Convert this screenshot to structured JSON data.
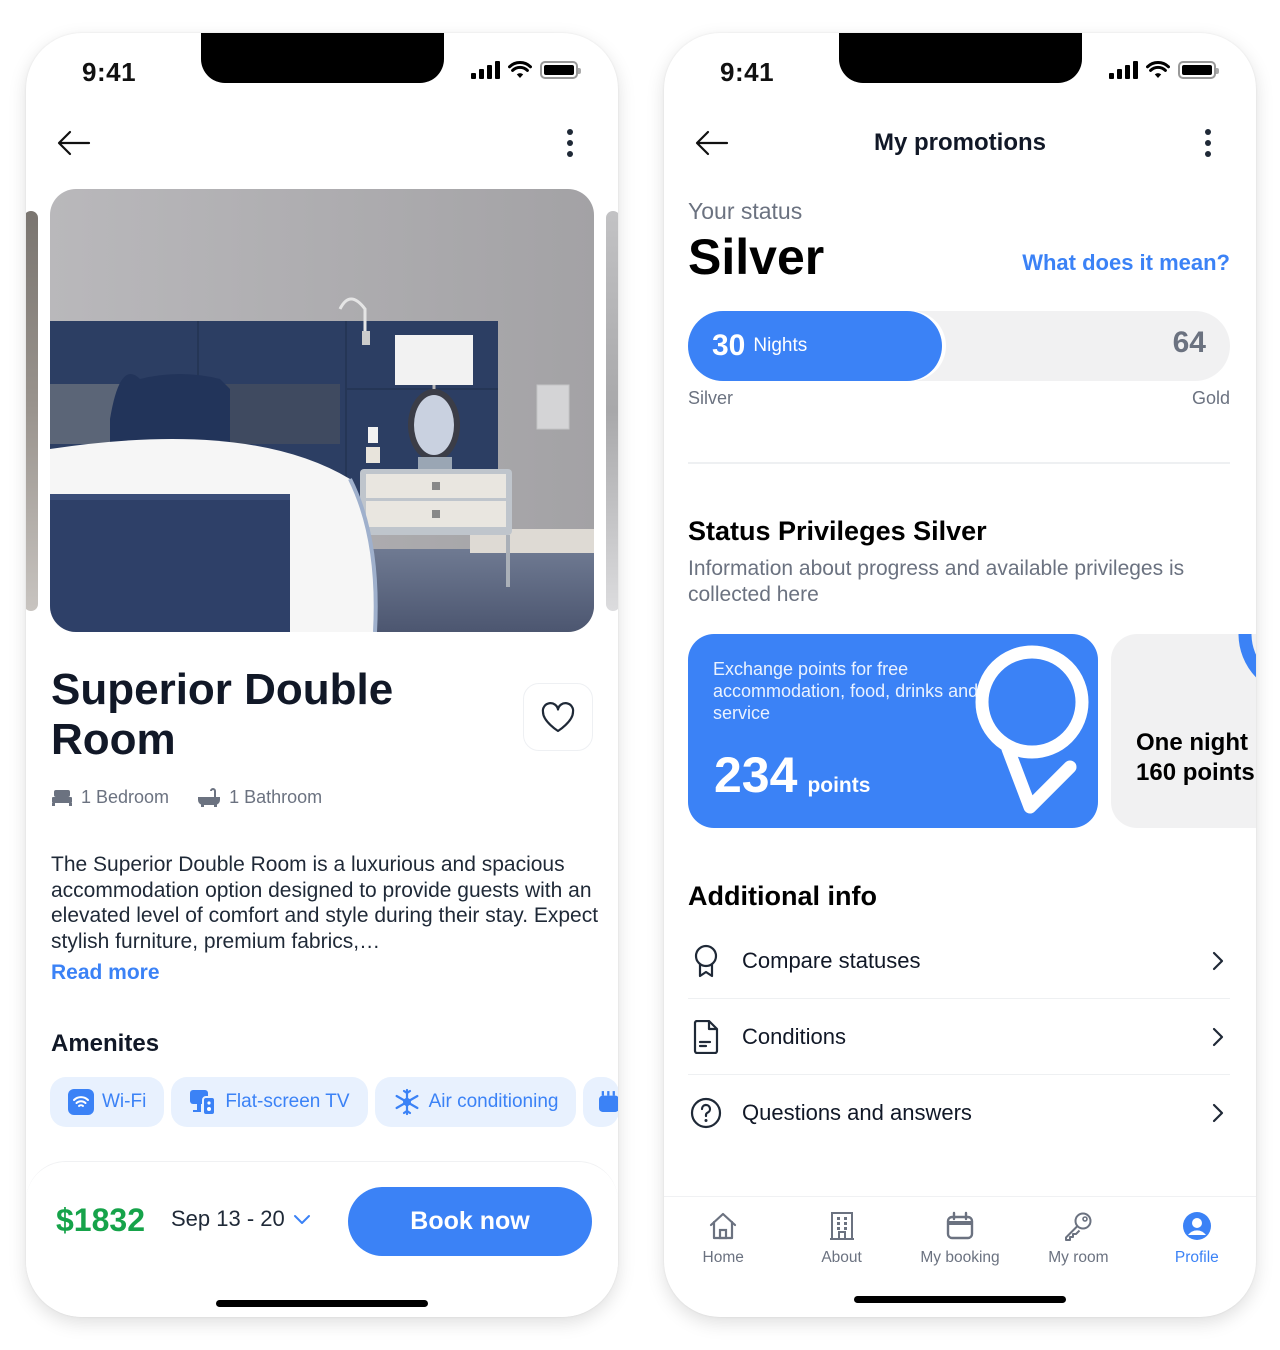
{
  "colors": {
    "accent": "#3b82f6",
    "price": "#16a34a",
    "chip_bg": "#e8f1fe",
    "text_primary": "#111827",
    "text_secondary": "#6b7280"
  },
  "room_screen": {
    "status_bar": {
      "time": "9:41"
    },
    "topbar": {
      "back_icon": "arrow-left-icon",
      "menu_icon": "more-vertical-icon"
    },
    "gallery": {
      "photo_alt": "Bedroom with navy headboard, white bedding and nightstand with lamp"
    },
    "title": "Superior Double Room",
    "favorite_icon": "heart-icon",
    "meta": [
      {
        "icon": "bed-icon",
        "label": "1 Bedroom"
      },
      {
        "icon": "bathtub-icon",
        "label": "1 Bathroom"
      }
    ],
    "description": "The Superior Double Room is a luxurious and spacious accommodation option designed to provide guests with an elevated level of comfort and style during their stay. Expect stylish furniture, premium fabrics,…",
    "read_more": "Read more",
    "amenities_title": "Amenites",
    "amenities": [
      {
        "icon": "wifi-icon",
        "label": "Wi-Fi"
      },
      {
        "icon": "tv-icon",
        "label": "Flat-screen TV"
      },
      {
        "icon": "snowflake-icon",
        "label": "Air conditioning"
      },
      {
        "icon": "calendar-icon",
        "label": ""
      }
    ],
    "booking": {
      "price": "$1832",
      "dates": "Sep 13 - 20",
      "book_label": "Book now"
    }
  },
  "promotions_screen": {
    "status_bar": {
      "time": "9:41"
    },
    "topbar": {
      "title": "My promotions",
      "back_icon": "arrow-left-icon",
      "menu_icon": "more-vertical-icon"
    },
    "status": {
      "label": "Your status",
      "value": "Silver",
      "link": "What does it mean?"
    },
    "progress": {
      "current": "30",
      "unit": "Nights",
      "target": "64",
      "fraction": 0.469,
      "from_tier": "Silver",
      "to_tier": "Gold"
    },
    "privileges": {
      "title": "Status Privileges Silver",
      "subtitle": "Information about progress and available privileges is collected here",
      "cards": [
        {
          "description": "Exchange points for free accommodation, food, drinks and service",
          "value": "234",
          "unit": "points"
        },
        {
          "line1": "One night",
          "line2": "160 points"
        }
      ]
    },
    "additional": {
      "title": "Additional info",
      "items": [
        {
          "icon": "award-icon",
          "label": "Compare statuses"
        },
        {
          "icon": "document-icon",
          "label": "Conditions"
        },
        {
          "icon": "help-circle-icon",
          "label": "Questions and answers"
        }
      ]
    },
    "tabs": [
      {
        "icon": "home-icon",
        "label": "Home",
        "active": false
      },
      {
        "icon": "building-icon",
        "label": "About",
        "active": false
      },
      {
        "icon": "calendar-icon",
        "label": "My booking",
        "active": false
      },
      {
        "icon": "key-icon",
        "label": "My room",
        "active": false
      },
      {
        "icon": "user-circle-icon",
        "label": "Profile",
        "active": true
      }
    ]
  }
}
